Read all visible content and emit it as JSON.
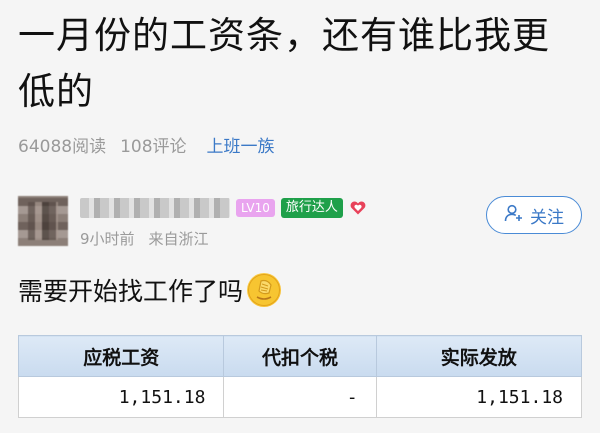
{
  "post": {
    "title": "一月份的工资条，还有谁比我更低的",
    "reads": "64088阅读",
    "comments": "108评论",
    "topic": "上班一族"
  },
  "author": {
    "level": "LV10",
    "badge": "旅行达人",
    "time": "9小时前",
    "source": "来自浙江",
    "follow_label": "关注"
  },
  "content": {
    "text": "需要开始找工作了吗"
  },
  "salary_table": {
    "headers": [
      "应税工资",
      "代扣个税",
      "实际发放"
    ],
    "row": [
      "1,151.18",
      "-",
      "1,151.18"
    ]
  },
  "colors": {
    "accent": "#3b79c7",
    "badge_green": "#1fa04a",
    "level_pink": "#e9a4ef",
    "heart_red": "#e8425a"
  }
}
